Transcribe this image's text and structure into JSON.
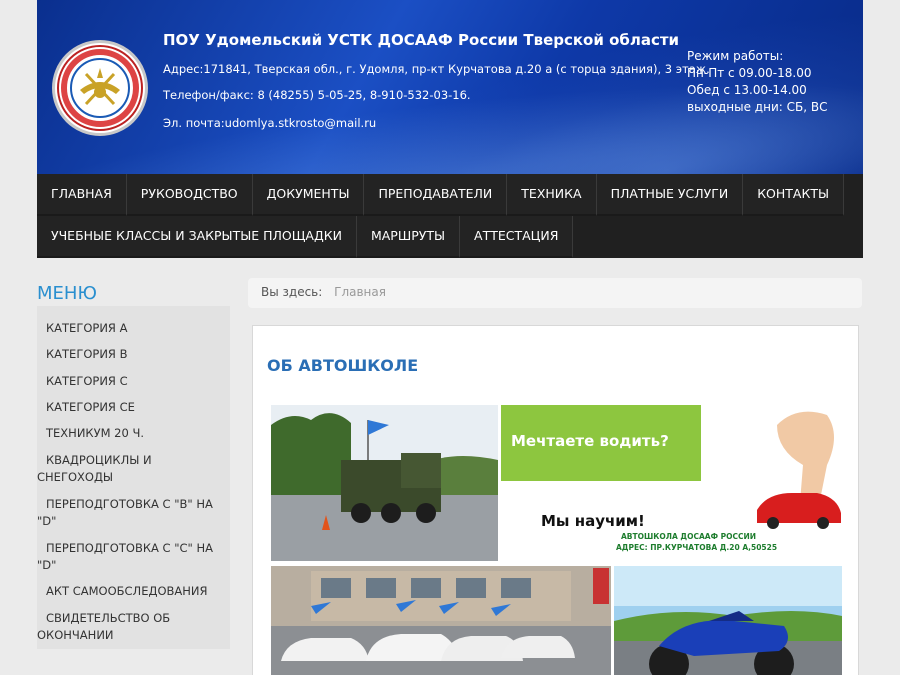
{
  "header": {
    "title": "ПОУ Удомельский УСТК ДОСААФ России Тверской области",
    "address": "Адрес:171841, Тверская обл., г. Удомля, пр-кт Курчатова д.20 а (с торца здания), 3 этаж.",
    "phone": "Телефон/факс: 8 (48255) 5-05-25, 8-910-532-03-16.",
    "email": "Эл. почта:udomlya.stkrosto@mail.ru",
    "hours": {
      "title": "Режим работы:",
      "weekdays": "Пн-Пт с 09.00-18.00",
      "lunch": "Обед с 13.00-14.00",
      "weekend": "выходные дни: СБ, ВС"
    },
    "logo_icon": "dosaaf-emblem-icon"
  },
  "nav": {
    "row1": [
      "ГЛАВНАЯ",
      "РУКОВОДСТВО",
      "ДОКУМЕНТЫ",
      "ПРЕПОДАВАТЕЛИ",
      "ТЕХНИКА",
      "ПЛАТНЫЕ УСЛУГИ",
      "КОНТАКТЫ"
    ],
    "row2": [
      "УЧЕБНЫЕ КЛАССЫ И ЗАКРЫТЫЕ ПЛОЩАДКИ",
      "МАРШРУТЫ",
      "АТТЕСТАЦИЯ"
    ]
  },
  "sidebar": {
    "title": "МЕНЮ",
    "items": [
      "КАТЕГОРИЯ А",
      "КАТЕГОРИЯ В",
      "КАТЕГОРИЯ С",
      "КАТЕГОРИЯ СЕ",
      "ТЕХНИКУМ 20 Ч.",
      "КВАДРОЦИКЛЫ И СНЕГОХОДЫ",
      "ПЕРЕПОДГОТОВКА С \"В\" НА \"D\"",
      "ПЕРЕПОДГОТОВКА С \"С\" НА \"D\"",
      "АКТ САМООБСЛЕДОВАНИЯ",
      "СВИДЕТЕЛЬСТВО ОБ ОКОНЧАНИИ"
    ]
  },
  "breadcrumb": {
    "here": "Вы здесь:",
    "current": "Главная"
  },
  "content": {
    "heading": "ОБ АВТОШКОЛЕ",
    "ad": {
      "question": "Мечтаете водить?",
      "answer": "Мы научим!",
      "school": "АВТОШКОЛА ДОСААФ РОССИИ",
      "address": "АДРЕС: ПР.КУРЧАТОВА Д.20 А,50525"
    }
  },
  "colors": {
    "header_blue": "#0e39a8",
    "nav_bg": "#202020",
    "menu_title": "#2a8fcf",
    "heading": "#2a6eb5",
    "ad_green": "#8dc63f"
  }
}
